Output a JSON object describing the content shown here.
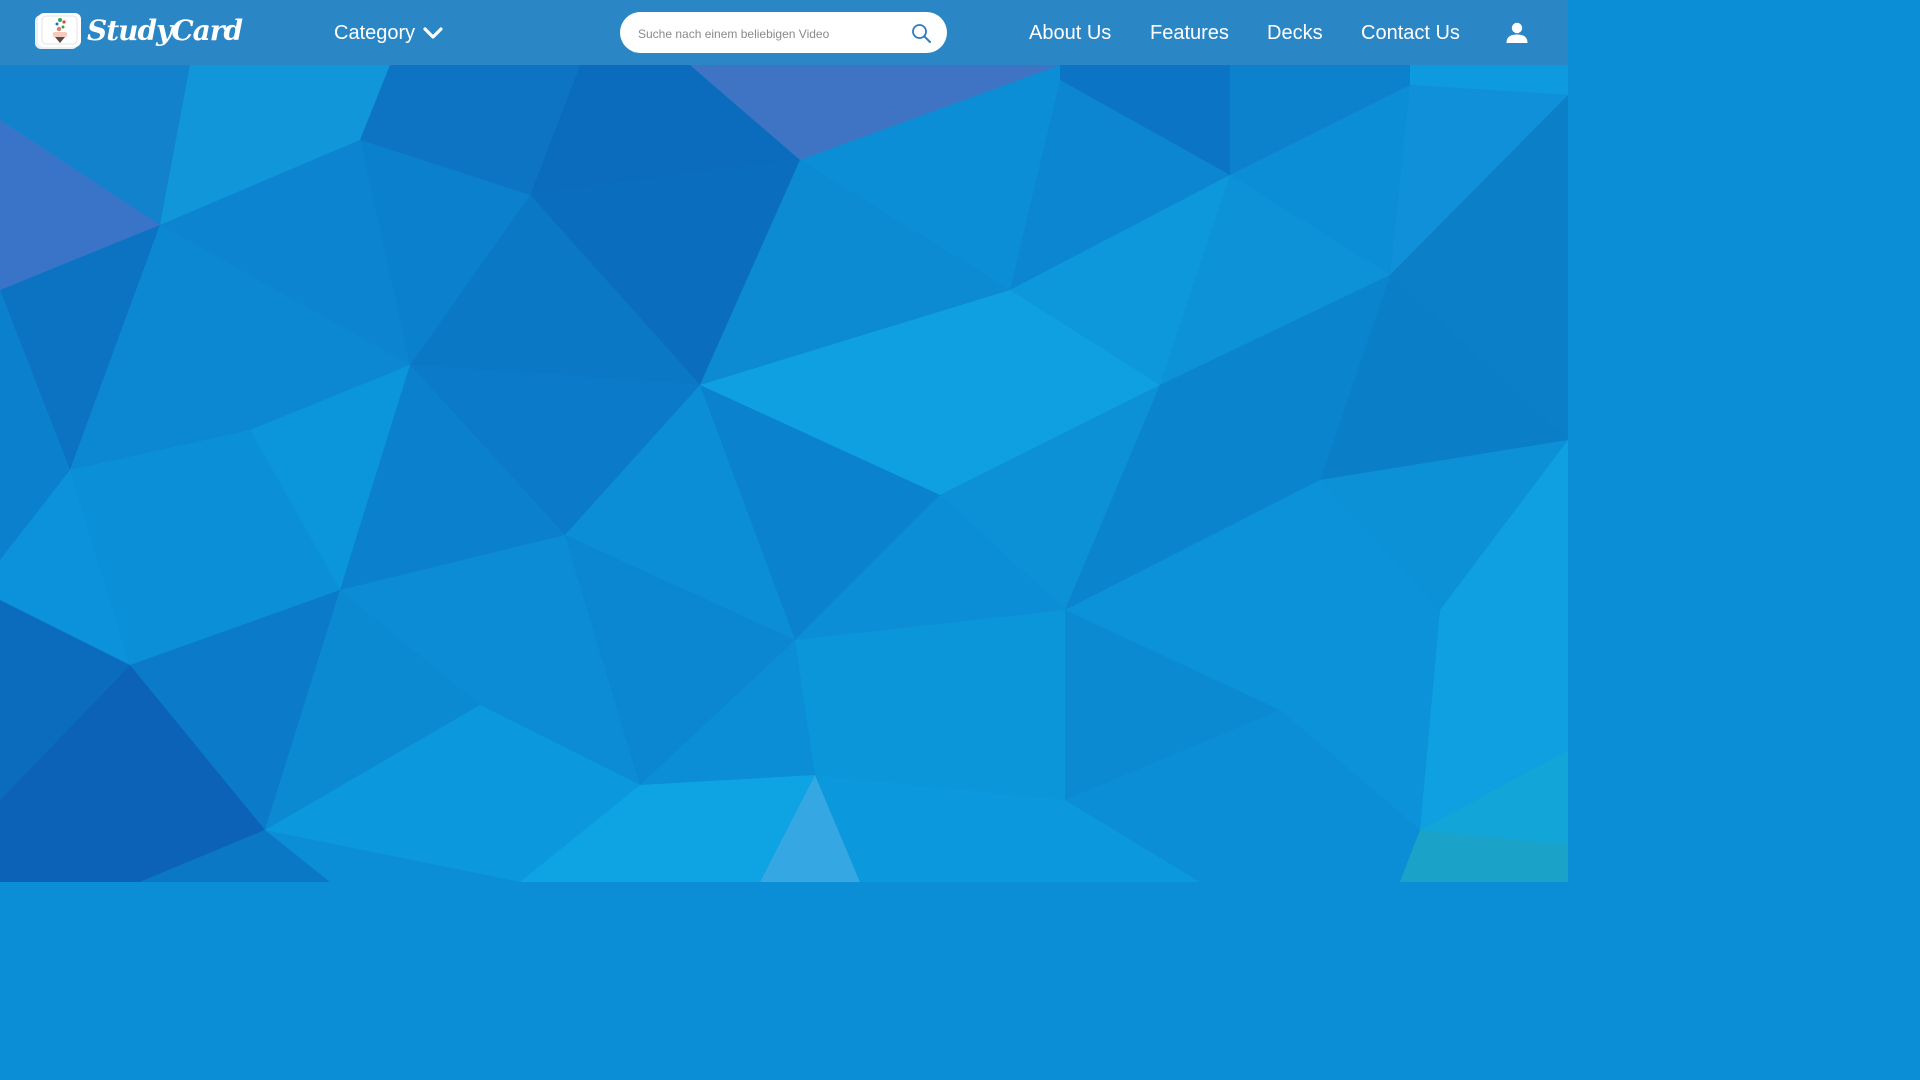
{
  "brand": {
    "name": "StudyCard"
  },
  "nav": {
    "category_label": "Category",
    "search_placeholder": "Suche nach einem beliebigen Video",
    "links": [
      "About Us",
      "Features",
      "Decks",
      "Contact Us"
    ]
  },
  "icons": {
    "logo": "flashcard-logo-icon",
    "category": "chevron-down-icon",
    "search": "search-icon",
    "account": "user-icon"
  },
  "colors": {
    "navbar": "#2b86c5",
    "background": "#0b8ed6",
    "text": "#ffffff"
  }
}
